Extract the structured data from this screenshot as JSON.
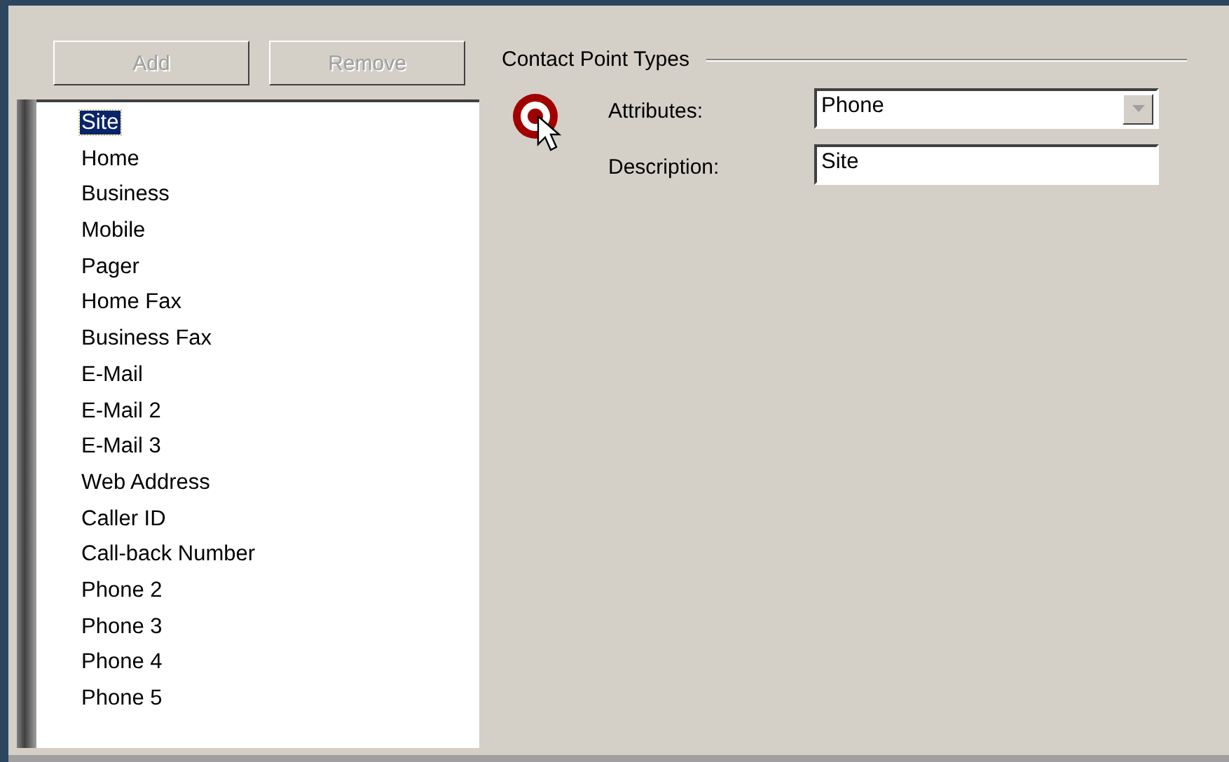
{
  "buttons": [
    {
      "label": "Add",
      "disabled": true
    },
    {
      "label": "Remove",
      "disabled": true
    }
  ],
  "list": {
    "items": [
      {
        "label": "Site",
        "selected": true
      },
      {
        "label": "Home",
        "selected": false
      },
      {
        "label": "Business",
        "selected": false
      },
      {
        "label": "Mobile",
        "selected": false
      },
      {
        "label": "Pager",
        "selected": false
      },
      {
        "label": "Home Fax",
        "selected": false
      },
      {
        "label": "Business Fax",
        "selected": false
      },
      {
        "label": "E-Mail",
        "selected": false
      },
      {
        "label": "E-Mail 2",
        "selected": false
      },
      {
        "label": "E-Mail 3",
        "selected": false
      },
      {
        "label": "Web Address",
        "selected": false
      },
      {
        "label": "Caller ID",
        "selected": false
      },
      {
        "label": "Call-back Number",
        "selected": false
      },
      {
        "label": "Phone 2",
        "selected": false
      },
      {
        "label": "Phone 3",
        "selected": false
      },
      {
        "label": "Phone 4",
        "selected": false
      },
      {
        "label": "Phone 5",
        "selected": false
      }
    ]
  },
  "group": {
    "title": "Contact Point Types",
    "fields": [
      {
        "kind": "dropdown",
        "label": "Attributes:",
        "value": "Phone"
      },
      {
        "kind": "text",
        "label": "Description:",
        "value": "Site"
      }
    ]
  }
}
